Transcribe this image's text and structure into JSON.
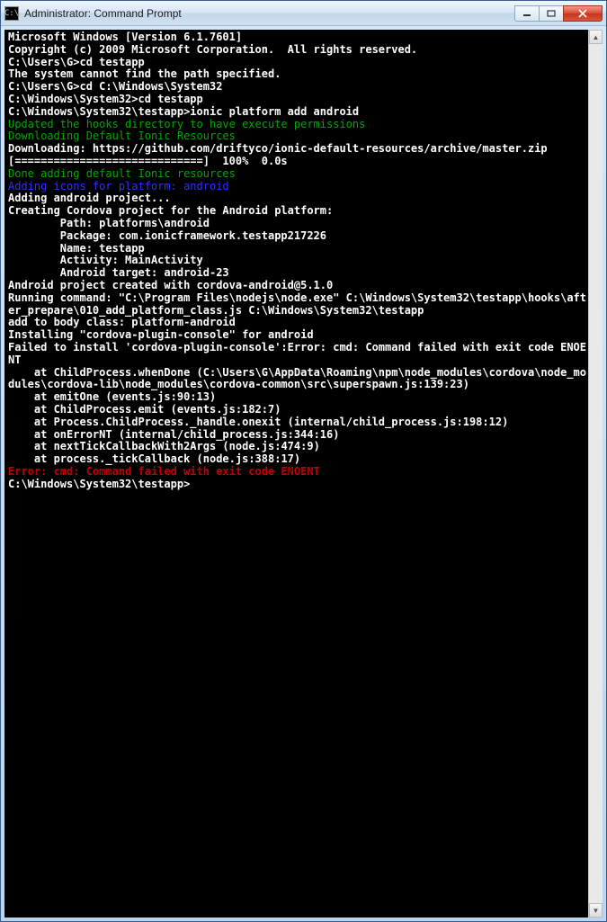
{
  "window": {
    "icon_text": "C:\\",
    "title": "Administrator: Command Prompt"
  },
  "terminal": {
    "lines": [
      {
        "cls": "white",
        "t": "Microsoft Windows [Version 6.1.7601]"
      },
      {
        "cls": "white",
        "t": "Copyright (c) 2009 Microsoft Corporation.  All rights reserved."
      },
      {
        "cls": "white",
        "t": ""
      },
      {
        "cls": "white",
        "t": "C:\\Users\\G>cd testapp"
      },
      {
        "cls": "white",
        "t": "The system cannot find the path specified."
      },
      {
        "cls": "white",
        "t": ""
      },
      {
        "cls": "white",
        "t": "C:\\Users\\G>cd C:\\Windows\\System32"
      },
      {
        "cls": "white",
        "t": ""
      },
      {
        "cls": "white",
        "t": "C:\\Windows\\System32>cd testapp"
      },
      {
        "cls": "white",
        "t": ""
      },
      {
        "cls": "white",
        "t": "C:\\Windows\\System32\\testapp>ionic platform add android"
      },
      {
        "cls": "green",
        "t": "Updated the hooks directory to have execute permissions"
      },
      {
        "cls": "green",
        "t": "Downloading Default Ionic Resources"
      },
      {
        "cls": "white",
        "t": "Downloading: https://github.com/driftyco/ionic-default-resources/archive/master.zip"
      },
      {
        "cls": "white",
        "t": "[=============================]  100%  0.0s"
      },
      {
        "cls": "green",
        "t": "Done adding default Ionic resources"
      },
      {
        "cls": "blue",
        "t": "Adding icons for platform: android"
      },
      {
        "cls": "white",
        "t": "Adding android project..."
      },
      {
        "cls": "white",
        "t": "Creating Cordova project for the Android platform:"
      },
      {
        "cls": "white",
        "t": "        Path: platforms\\android"
      },
      {
        "cls": "white",
        "t": "        Package: com.ionicframework.testapp217226"
      },
      {
        "cls": "white",
        "t": "        Name: testapp"
      },
      {
        "cls": "white",
        "t": "        Activity: MainActivity"
      },
      {
        "cls": "white",
        "t": "        Android target: android-23"
      },
      {
        "cls": "white",
        "t": "Android project created with cordova-android@5.1.0"
      },
      {
        "cls": "white",
        "t": "Running command: \"C:\\Program Files\\nodejs\\node.exe\" C:\\Windows\\System32\\testapp\\hooks\\after_prepare\\010_add_platform_class.js C:\\Windows\\System32\\testapp"
      },
      {
        "cls": "white",
        "t": "add to body class: platform-android"
      },
      {
        "cls": "white",
        "t": "Installing \"cordova-plugin-console\" for android"
      },
      {
        "cls": "white",
        "t": "Failed to install 'cordova-plugin-console':Error: cmd: Command failed with exit code ENOENT"
      },
      {
        "cls": "white",
        "t": "    at ChildProcess.whenDone (C:\\Users\\G\\AppData\\Roaming\\npm\\node_modules\\cordova\\node_modules\\cordova-lib\\node_modules\\cordova-common\\src\\superspawn.js:139:23)"
      },
      {
        "cls": "white",
        "t": ""
      },
      {
        "cls": "white",
        "t": "    at emitOne (events.js:90:13)"
      },
      {
        "cls": "white",
        "t": "    at ChildProcess.emit (events.js:182:7)"
      },
      {
        "cls": "white",
        "t": "    at Process.ChildProcess._handle.onexit (internal/child_process.js:198:12)"
      },
      {
        "cls": "white",
        "t": "    at onErrorNT (internal/child_process.js:344:16)"
      },
      {
        "cls": "white",
        "t": "    at nextTickCallbackWith2Args (node.js:474:9)"
      },
      {
        "cls": "white",
        "t": "    at process._tickCallback (node.js:388:17)"
      },
      {
        "cls": "red",
        "t": "Error: cmd: Command failed with exit code ENOENT"
      },
      {
        "cls": "white",
        "t": ""
      },
      {
        "cls": "white",
        "t": "C:\\Windows\\System32\\testapp>"
      }
    ]
  }
}
